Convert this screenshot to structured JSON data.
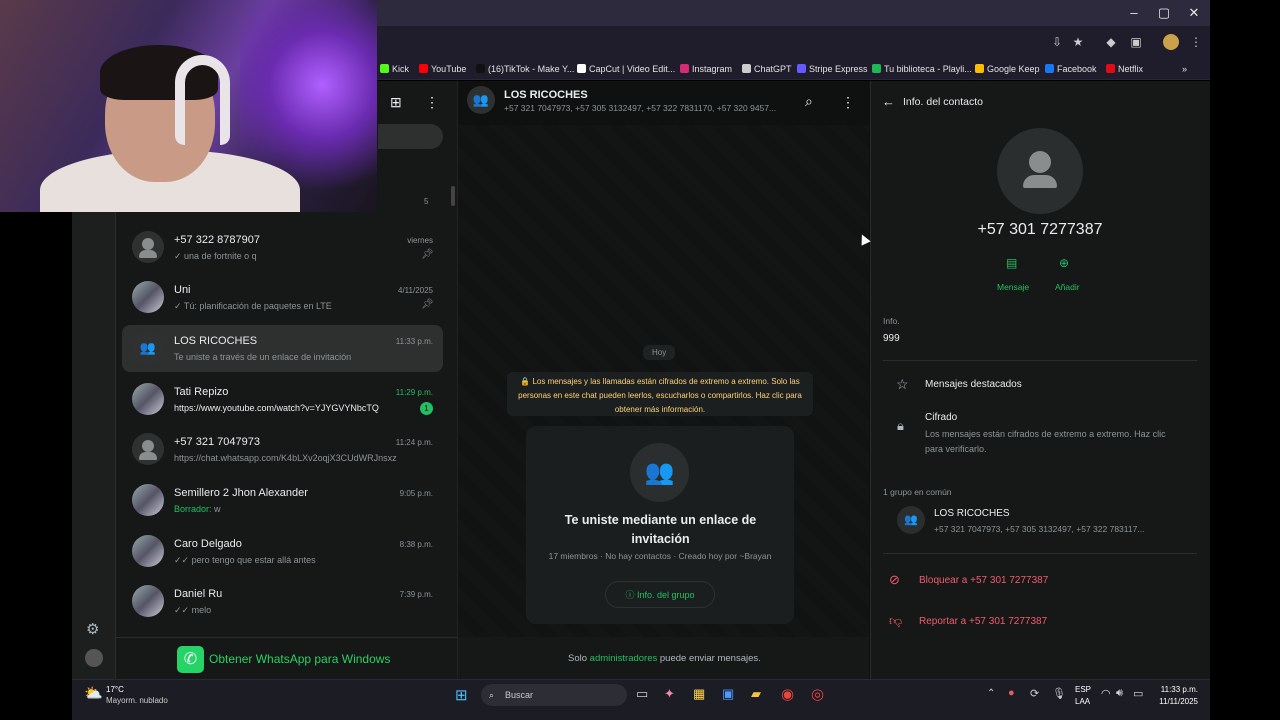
{
  "browser": {
    "window_controls": {
      "minimize": "–",
      "maximize": "▢",
      "close": "✕"
    },
    "bookmarks": [
      {
        "label": "Kick",
        "color": "#53fc18"
      },
      {
        "label": "YouTube",
        "color": "#ff0000"
      },
      {
        "label": "(16)TikTok - Make Y...",
        "color": "#111111"
      },
      {
        "label": "CapCut | Video Edit...",
        "color": "#ffffff"
      },
      {
        "label": "Instagram",
        "color": "#d62976"
      },
      {
        "label": "ChatGPT",
        "color": "#cccccc"
      },
      {
        "label": "Stripe Express",
        "color": "#635bff"
      },
      {
        "label": "Tu biblioteca - Playli...",
        "color": "#1db954"
      },
      {
        "label": "Google Keep",
        "color": "#fbbc04"
      },
      {
        "label": "Facebook",
        "color": "#1877f2"
      },
      {
        "label": "Netflix",
        "color": "#e50914"
      }
    ],
    "more_bookmarks": "»"
  },
  "chat_list": {
    "unread_count": "5",
    "chats": [
      {
        "name": "+57 322 8787907",
        "message": "✓ una de fortnite o q",
        "time": "viernes",
        "pinned": true,
        "avatar": "default"
      },
      {
        "name": "Uni",
        "message": "✓ Tú: planificación de paquetes en LTE",
        "time": "4/11/2025",
        "pinned": true,
        "avatar": "photo"
      },
      {
        "name": "LOS RICOCHES",
        "message": "Te uniste a través de un enlace de invitación",
        "time": "11:33 p.m.",
        "pinned": false,
        "avatar": "group"
      },
      {
        "name": "Tati Repizo",
        "message": "https://www.youtube.com/watch?v=YJYGVYNbcTQ",
        "time": "11:29 p.m.",
        "unread": "1",
        "avatar": "photo"
      },
      {
        "name": "+57 321 7047973",
        "message": "https://chat.whatsapp.com/K4bLXv2oqjX3CUdWRJnsxz",
        "time": "11:24 p.m.",
        "avatar": "default"
      },
      {
        "name": "Semillero 2 Jhon Alexander",
        "draft_label": "Borrador:",
        "message": "w",
        "time": "9:05 p.m.",
        "avatar": "photo"
      },
      {
        "name": "Caro Delgado",
        "message": "✓✓ pero tengo que estar allá antes",
        "time": "8:38 p.m.",
        "avatar": "photo"
      },
      {
        "name": "Daniel Ru",
        "message": "✓✓ melo",
        "time": "7:39 p.m.",
        "avatar": "photo"
      }
    ],
    "get_app": "Obtener WhatsApp para Windows"
  },
  "chat": {
    "title": "LOS RICOCHES",
    "subtitle": "+57 321 7047973, +57 305 3132497, +57 322 7831170, +57 320 9457...",
    "date_chip": "Hoy",
    "encryption_notice": "🔒 Los mensajes y las llamadas están cifrados de extremo a extremo. Solo las personas en este chat pueden leerlos, escucharlos o compartirlos. Haz clic para obtener más información.",
    "invite_title": "Te uniste mediante un enlace de invitación",
    "invite_meta": "17 miembros · No hay contactos · Creado hoy por ~Brayan",
    "group_info_button": "Info. del grupo",
    "footer_prefix": "Solo",
    "footer_link": "administradores",
    "footer_suffix": "puede enviar mensajes."
  },
  "contact_info": {
    "header": "Info. del contacto",
    "phone": "+57 301 7277387",
    "message_label": "Mensaje",
    "add_label": "Añadir",
    "info_label": "Info.",
    "info_value": "999",
    "starred": "Mensajes destacados",
    "encrypted_title": "Cifrado",
    "encrypted_desc": "Los mensajes están cifrados de extremo a extremo. Haz clic para verificarlo.",
    "common_groups_label": "1 grupo en común",
    "group_name": "LOS RICOCHES",
    "group_members": "+57 321 7047973, +57 305 3132497, +57 322 783117...",
    "block": "Bloquear a +57 301 7277387",
    "report": "Reportar a +57 301 7277387"
  },
  "taskbar": {
    "weather_temp": "17°C",
    "weather_desc": "Mayorm. nublado",
    "search": "Buscar",
    "lang": "ESP",
    "lang2": "LAA",
    "time": "11:33 p.m.",
    "date": "11/11/2025"
  }
}
